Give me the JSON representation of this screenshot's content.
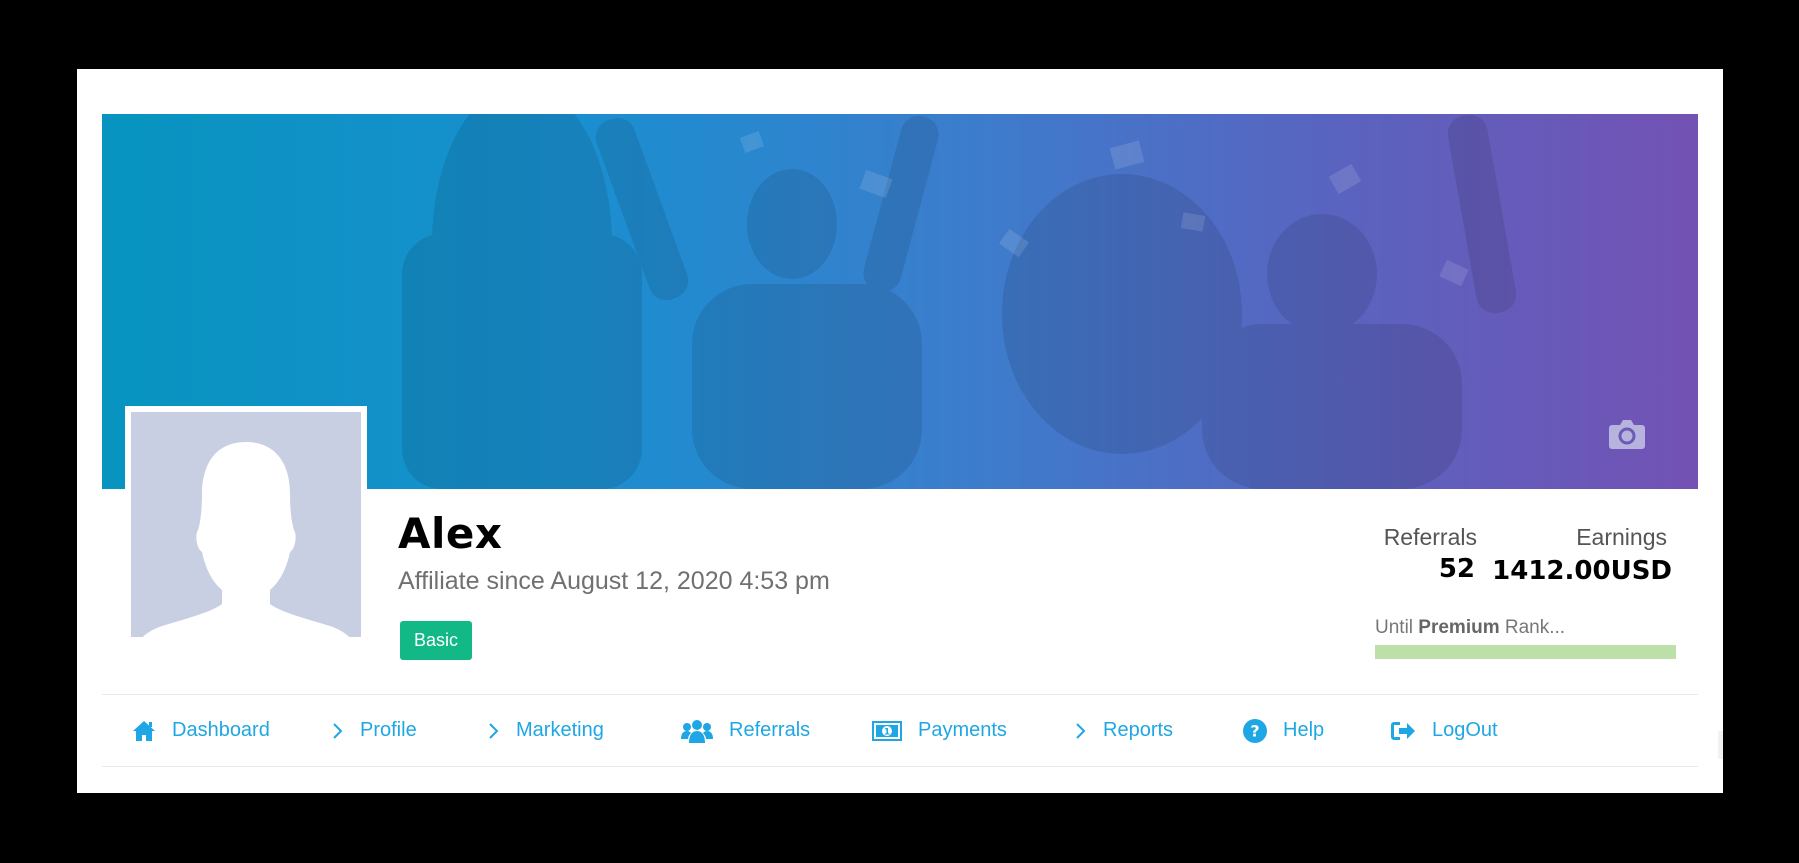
{
  "profile": {
    "name": "Alex",
    "since": "Affiliate since August 12, 2020 4:53 pm",
    "badge": "Basic"
  },
  "stats": {
    "referrals_label": "Referrals",
    "referrals_value": "52",
    "earnings_label": "Earnings",
    "earnings_value": "1412.00USD"
  },
  "rank": {
    "prefix": "Until",
    "name": "Premium",
    "suffix": "Rank...",
    "progress": 1.0
  },
  "nav": {
    "items": [
      {
        "label": "Dashboard",
        "icon": "home-icon"
      },
      {
        "label": "Profile",
        "icon": "chevron-right-icon"
      },
      {
        "label": "Marketing",
        "icon": "chevron-right-icon"
      },
      {
        "label": "Referrals",
        "icon": "users-icon"
      },
      {
        "label": "Payments",
        "icon": "money-icon"
      },
      {
        "label": "Reports",
        "icon": "chevron-right-icon"
      },
      {
        "label": "Help",
        "icon": "question-circle-icon"
      },
      {
        "label": "LogOut",
        "icon": "sign-out-icon"
      }
    ]
  },
  "colors": {
    "accent": "#1ea7e4",
    "badge": "#12b886",
    "cover_start": "#0794bf",
    "cover_end": "#7352b4",
    "rank_bar": "#bde0a9"
  }
}
